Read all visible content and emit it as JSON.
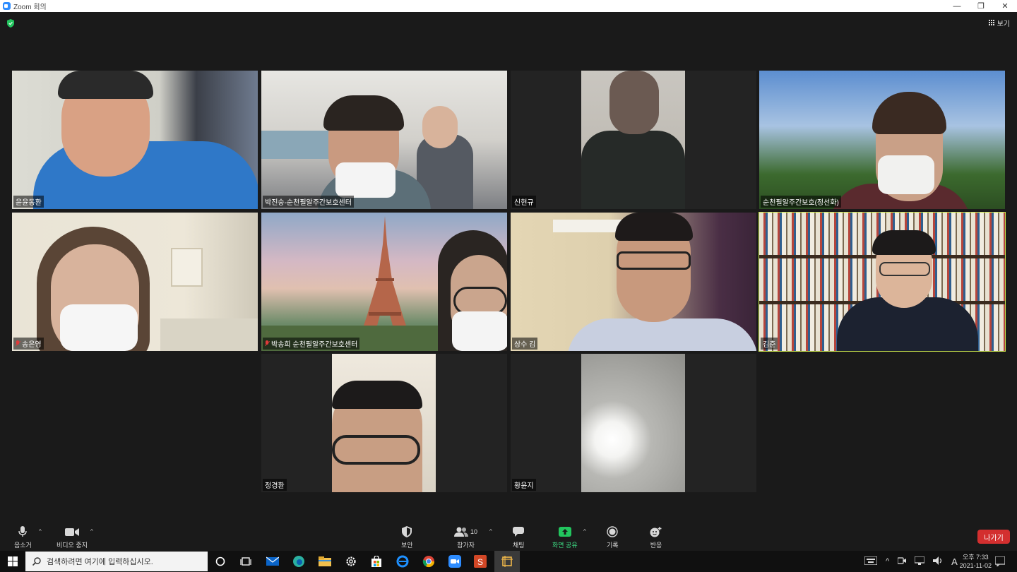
{
  "window": {
    "title": "Zoom 회의"
  },
  "meeting": {
    "view_label": "보기"
  },
  "participants": [
    {
      "name": "윤윤동환",
      "muted": false
    },
    {
      "name": "박진숭-순천필알주간보호센터",
      "muted": false
    },
    {
      "name": "신현규",
      "muted": false
    },
    {
      "name": "순천필알주간보호(정선화)",
      "muted": false
    },
    {
      "name": "송은영",
      "muted": true
    },
    {
      "name": "박송희 순천필알주간보호센터",
      "muted": true
    },
    {
      "name": "상수 김",
      "muted": false
    },
    {
      "name": "김춘",
      "muted": false,
      "active_speaker": true
    },
    {
      "name": "정경환",
      "muted": false
    },
    {
      "name": "황윤지",
      "muted": false
    }
  ],
  "controls": {
    "mute": "음소거",
    "video": "비디오 중지",
    "security": "보안",
    "participants": "참가자",
    "participants_count": "10",
    "chat": "채팅",
    "share": "화면 공유",
    "record": "기록",
    "reactions": "반응",
    "leave": "나가기"
  },
  "taskbar": {
    "search_placeholder": "검색하려면 여기에 입력하십시오.",
    "time": "오후 7:33",
    "date": "2021-11-02",
    "lang": "A"
  },
  "colors": {
    "accent_active_speaker": "#c7e24a",
    "leave": "#d32f2f",
    "share": "#22c55e",
    "zoom_blue": "#2d8cff"
  }
}
